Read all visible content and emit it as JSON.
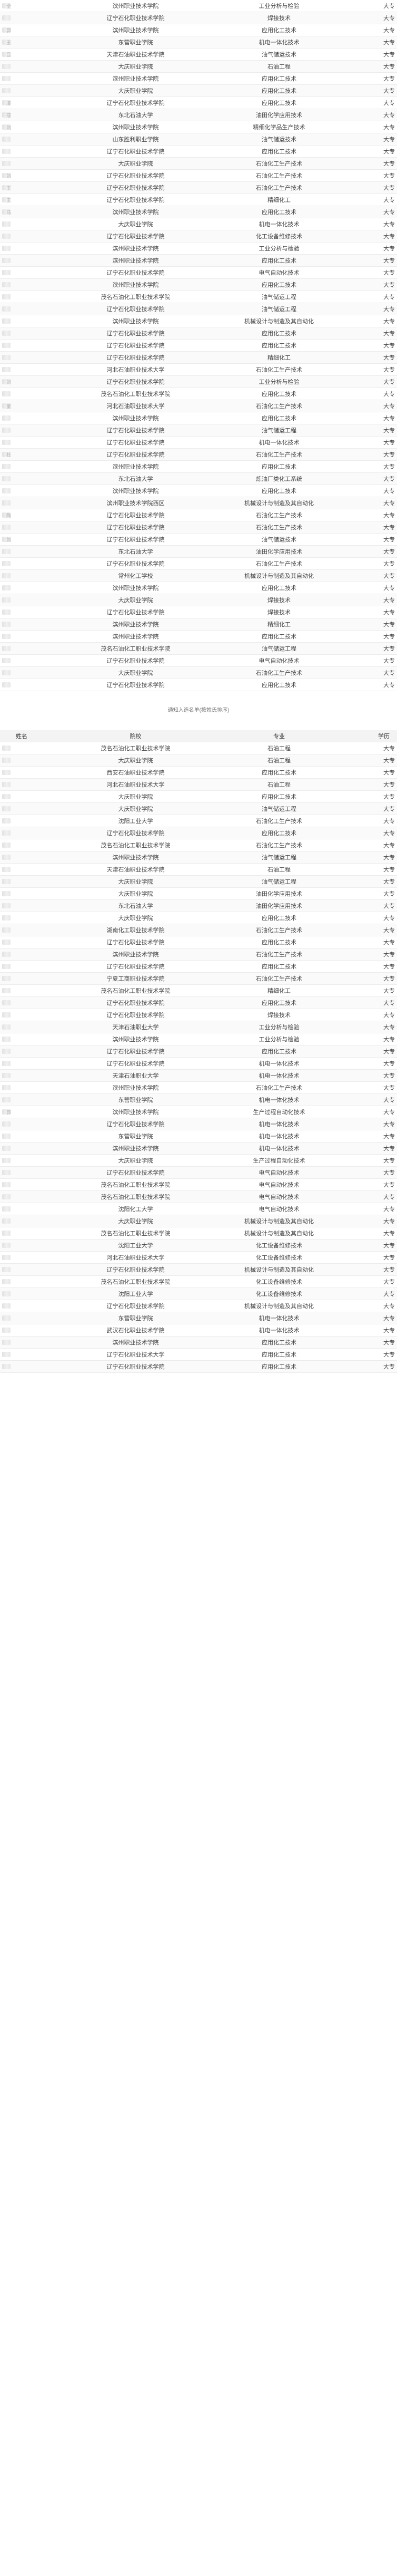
{
  "section1": {
    "rows": [
      {
        "school": "滨州职业技术学院",
        "major": "工业分析与检验",
        "edu": "大专",
        "frag": "全"
      },
      {
        "school": "辽宁石化职业技术学院",
        "major": "焊接技术",
        "edu": "大专",
        "frag": ""
      },
      {
        "school": "滨州职业技术学院",
        "major": "应用化工技术",
        "edu": "大专",
        "frag": "郭"
      },
      {
        "school": "东营职业学院",
        "major": "机电一体化技术",
        "edu": "大专",
        "frag": "王"
      },
      {
        "school": "天津石油职业技术学院",
        "major": "油气储运技术",
        "edu": "大专",
        "frag": "吕"
      },
      {
        "school": "大庆职业学院",
        "major": "石油工程",
        "edu": "大专",
        "frag": ""
      },
      {
        "school": "滨州职业技术学院",
        "major": "应用化工技术",
        "edu": "大专",
        "frag": ""
      },
      {
        "school": "大庆职业学院",
        "major": "应用化工技术",
        "edu": "大专",
        "frag": ""
      },
      {
        "school": "辽宁石化职业技术学院",
        "major": "应用化工技术",
        "edu": "大专",
        "frag": "凌"
      },
      {
        "school": "东北石油大学",
        "major": "油田化学应用技术",
        "edu": "大专",
        "frag": "寇"
      },
      {
        "school": "滨州职业技术学院",
        "major": "精细化学品生产技术",
        "edu": "大专",
        "frag": "刘"
      },
      {
        "school": "山东胜利职业学院",
        "major": "油气储运技术",
        "edu": "大专",
        "frag": ""
      },
      {
        "school": "辽宁石化职业技术学院",
        "major": "应用化工技术",
        "edu": "大专",
        "frag": ""
      },
      {
        "school": "大庆职业学院",
        "major": "石油化工生产技术",
        "edu": "大专",
        "frag": ""
      },
      {
        "school": "辽宁石化职业技术学院",
        "major": "石油化工生产技术",
        "edu": "大专",
        "frag": "刘"
      },
      {
        "school": "辽宁石化职业技术学院",
        "major": "石油化工生产技术",
        "edu": "大专",
        "frag": "王"
      },
      {
        "school": "辽宁石化职业技术学院",
        "major": "精细化工",
        "edu": "大专",
        "frag": "王"
      },
      {
        "school": "滨州职业技术学院",
        "major": "应用化工技术",
        "edu": "大专",
        "frag": "马"
      },
      {
        "school": "大庆职业学院",
        "major": "机电一体化技术",
        "edu": "大专",
        "frag": ""
      },
      {
        "school": "辽宁石化职业技术学院",
        "major": "化工设备维修技术",
        "edu": "大专",
        "frag": ""
      },
      {
        "school": "滨州职业技术学院",
        "major": "工业分析与检验",
        "edu": "大专",
        "frag": ""
      },
      {
        "school": "滨州职业技术学院",
        "major": "应用化工技术",
        "edu": "大专",
        "frag": ""
      },
      {
        "school": "辽宁石化职业技术学院",
        "major": "电气自动化技术",
        "edu": "大专",
        "frag": ""
      },
      {
        "school": "滨州职业技术学院",
        "major": "应用化工技术",
        "edu": "大专",
        "frag": ""
      },
      {
        "school": "茂名石油化工职业技术学院",
        "major": "油气储运工程",
        "edu": "大专",
        "frag": ""
      },
      {
        "school": "辽宁石化职业技术学院",
        "major": "油气储运工程",
        "edu": "大专",
        "frag": ""
      },
      {
        "school": "滨州职业技术学院",
        "major": "机械设计与制造及其自动化",
        "edu": "大专",
        "frag": ""
      },
      {
        "school": "辽宁石化职业技术学院",
        "major": "应用化工技术",
        "edu": "大专",
        "frag": ""
      },
      {
        "school": "辽宁石化职业技术学院",
        "major": "应用化工技术",
        "edu": "大专",
        "frag": ""
      },
      {
        "school": "辽宁石化职业技术学院",
        "major": "精细化工",
        "edu": "大专",
        "frag": ""
      },
      {
        "school": "河北石油职业技术大学",
        "major": "石油化工生产技术",
        "edu": "大专",
        "frag": ""
      },
      {
        "school": "辽宁石化职业技术学院",
        "major": "工业分析与检验",
        "edu": "大专",
        "frag": "刘"
      },
      {
        "school": "茂名石油化工职业技术学院",
        "major": "应用化工技术",
        "edu": "大专",
        "frag": ""
      },
      {
        "school": "河北石油职业技术大学",
        "major": "石油化工生产技术",
        "edu": "大专",
        "frag": "董"
      },
      {
        "school": "滨州职业技术学院",
        "major": "应用化工技术",
        "edu": "大专",
        "frag": ""
      },
      {
        "school": "辽宁石化职业技术学院",
        "major": "油气储运工程",
        "edu": "大专",
        "frag": ""
      },
      {
        "school": "辽宁石化职业技术学院",
        "major": "机电一体化技术",
        "edu": "大专",
        "frag": ""
      },
      {
        "school": "辽宁石化职业技术学院",
        "major": "石油化工生产技术",
        "edu": "大专",
        "frag": "杜"
      },
      {
        "school": "滨州职业技术学院",
        "major": "应用化工技术",
        "edu": "大专",
        "frag": ""
      },
      {
        "school": "东北石油大学",
        "major": "炼油厂类化工系统",
        "edu": "大专",
        "frag": ""
      },
      {
        "school": "滨州职业技术学院",
        "major": "应用化工技术",
        "edu": "大专",
        "frag": ""
      },
      {
        "school": "滨州职业技术学院西区",
        "major": "机械设计与制造及其自动化",
        "edu": "大专",
        "frag": ""
      },
      {
        "school": "辽宁石化职业技术学院",
        "major": "石油化工生产技术",
        "edu": "大专",
        "frag": "陶"
      },
      {
        "school": "辽宁石化职业技术学院",
        "major": "石油化工生产技术",
        "edu": "大专",
        "frag": ""
      },
      {
        "school": "辽宁石化职业技术学院",
        "major": "油气储运技术",
        "edu": "大专",
        "frag": "刘"
      },
      {
        "school": "东北石油大学",
        "major": "油田化学应用技术",
        "edu": "大专",
        "frag": ""
      },
      {
        "school": "辽宁石化职业技术学院",
        "major": "石油化工生产技术",
        "edu": "大专",
        "frag": ""
      },
      {
        "school": "常州化工学校",
        "major": "机械设计与制造及其自动化",
        "edu": "大专",
        "frag": ""
      },
      {
        "school": "滨州职业技术学院",
        "major": "应用化工技术",
        "edu": "大专",
        "frag": ""
      },
      {
        "school": "大庆职业学院",
        "major": "焊接技术",
        "edu": "大专",
        "frag": ""
      },
      {
        "school": "辽宁石化职业技术学院",
        "major": "焊接技术",
        "edu": "大专",
        "frag": ""
      },
      {
        "school": "滨州职业技术学院",
        "major": "精细化工",
        "edu": "大专",
        "frag": ""
      },
      {
        "school": "滨州职业技术学院",
        "major": "应用化工技术",
        "edu": "大专",
        "frag": ""
      },
      {
        "school": "茂名石油化工职业技术学院",
        "major": "油气储运工程",
        "edu": "大专",
        "frag": ""
      },
      {
        "school": "辽宁石化职业技术学院",
        "major": "电气自动化技术",
        "edu": "大专",
        "frag": ""
      },
      {
        "school": "大庆职业学院",
        "major": "石油化工生产技术",
        "edu": "大专",
        "frag": ""
      },
      {
        "school": "辽宁石化职业技术学院",
        "major": "应用化工技术",
        "edu": "大专",
        "frag": ""
      }
    ],
    "caption": "通知入选名单(按姓氏排序)"
  },
  "section2": {
    "headers": {
      "name": "姓名",
      "school": "院校",
      "major": "专业",
      "edu": "学历"
    },
    "rows": [
      {
        "school": "茂名石油化工职业技术学院",
        "major": "石油工程",
        "edu": "大专",
        "frag": ""
      },
      {
        "school": "大庆职业学院",
        "major": "石油工程",
        "edu": "大专",
        "frag": ""
      },
      {
        "school": "西安石油职业技术学院",
        "major": "应用化工技术",
        "edu": "大专",
        "frag": ""
      },
      {
        "school": "河北石油职业技术大学",
        "major": "石油工程",
        "edu": "大专",
        "frag": ""
      },
      {
        "school": "大庆职业学院",
        "major": "应用化工技术",
        "edu": "大专",
        "frag": ""
      },
      {
        "school": "大庆职业学院",
        "major": "油气储运工程",
        "edu": "大专",
        "frag": ""
      },
      {
        "school": "沈阳工业大学",
        "major": "石油化工生产技术",
        "edu": "大专",
        "frag": ""
      },
      {
        "school": "辽宁石化职业技术学院",
        "major": "应用化工技术",
        "edu": "大专",
        "frag": ""
      },
      {
        "school": "茂名石油化工职业技术学院",
        "major": "石油化工生产技术",
        "edu": "大专",
        "frag": ""
      },
      {
        "school": "滨州职业技术学院",
        "major": "油气储运工程",
        "edu": "大专",
        "frag": ""
      },
      {
        "school": "天津石油职业技术学院",
        "major": "石油工程",
        "edu": "大专",
        "frag": ""
      },
      {
        "school": "大庆职业学院",
        "major": "油气储运工程",
        "edu": "大专",
        "frag": ""
      },
      {
        "school": "大庆职业学院",
        "major": "油田化学应用技术",
        "edu": "大专",
        "frag": ""
      },
      {
        "school": "东北石油大学",
        "major": "油田化学应用技术",
        "edu": "大专",
        "frag": ""
      },
      {
        "school": "大庆职业学院",
        "major": "应用化工技术",
        "edu": "大专",
        "frag": ""
      },
      {
        "school": "湖南化工职业技术学院",
        "major": "石油化工生产技术",
        "edu": "大专",
        "frag": ""
      },
      {
        "school": "辽宁石化职业技术学院",
        "major": "应用化工技术",
        "edu": "大专",
        "frag": ""
      },
      {
        "school": "滨州职业技术学院",
        "major": "石油化工生产技术",
        "edu": "大专",
        "frag": ""
      },
      {
        "school": "辽宁石化职业技术学院",
        "major": "应用化工技术",
        "edu": "大专",
        "frag": ""
      },
      {
        "school": "宁夏工商职业技术学院",
        "major": "石油化工生产技术",
        "edu": "大专",
        "frag": ""
      },
      {
        "school": "茂名石油化工职业技术学院",
        "major": "精细化工",
        "edu": "大专",
        "frag": ""
      },
      {
        "school": "辽宁石化职业技术学院",
        "major": "应用化工技术",
        "edu": "大专",
        "frag": ""
      },
      {
        "school": "辽宁石化职业技术学院",
        "major": "焊接技术",
        "edu": "大专",
        "frag": ""
      },
      {
        "school": "天津石油职业大学",
        "major": "工业分析与检验",
        "edu": "大专",
        "frag": ""
      },
      {
        "school": "滨州职业技术学院",
        "major": "工业分析与检验",
        "edu": "大专",
        "frag": ""
      },
      {
        "school": "辽宁石化职业技术学院",
        "major": "应用化工技术",
        "edu": "大专",
        "frag": ""
      },
      {
        "school": "辽宁石化职业技术学院",
        "major": "机电一体化技术",
        "edu": "大专",
        "frag": ""
      },
      {
        "school": "天津石油职业大学",
        "major": "机电一体化技术",
        "edu": "大专",
        "frag": ""
      },
      {
        "school": "滨州职业技术学院",
        "major": "石油化工生产技术",
        "edu": "大专",
        "frag": ""
      },
      {
        "school": "东营职业学院",
        "major": "机电一体化技术",
        "edu": "大专",
        "frag": ""
      },
      {
        "school": "滨州职业技术学院",
        "major": "生产过程自动化技术",
        "edu": "大专",
        "frag": "郭"
      },
      {
        "school": "辽宁石化职业技术学院",
        "major": "机电一体化技术",
        "edu": "大专",
        "frag": ""
      },
      {
        "school": "东营职业学院",
        "major": "机电一体化技术",
        "edu": "大专",
        "frag": ""
      },
      {
        "school": "滨州职业技术学院",
        "major": "机电一体化技术",
        "edu": "大专",
        "frag": ""
      },
      {
        "school": "大庆职业学院",
        "major": "生产过程自动化技术",
        "edu": "大专",
        "frag": ""
      },
      {
        "school": "辽宁石化职业技术学院",
        "major": "电气自动化技术",
        "edu": "大专",
        "frag": ""
      },
      {
        "school": "茂名石油化工职业技术学院",
        "major": "电气自动化技术",
        "edu": "大专",
        "frag": ""
      },
      {
        "school": "茂名石油化工职业技术学院",
        "major": "电气自动化技术",
        "edu": "大专",
        "frag": ""
      },
      {
        "school": "沈阳化工大学",
        "major": "电气自动化技术",
        "edu": "大专",
        "frag": ""
      },
      {
        "school": "大庆职业学院",
        "major": "机械设计与制造及其自动化",
        "edu": "大专",
        "frag": ""
      },
      {
        "school": "茂名石油化工职业技术学院",
        "major": "机械设计与制造及其自动化",
        "edu": "大专",
        "frag": ""
      },
      {
        "school": "沈阳工业大学",
        "major": "化工设备维修技术",
        "edu": "大专",
        "frag": ""
      },
      {
        "school": "河北石油职业技术大学",
        "major": "化工设备维修技术",
        "edu": "大专",
        "frag": ""
      },
      {
        "school": "辽宁石化职业技术学院",
        "major": "机械设计与制造及其自动化",
        "edu": "大专",
        "frag": ""
      },
      {
        "school": "茂名石油化工职业技术学院",
        "major": "化工设备维修技术",
        "edu": "大专",
        "frag": ""
      },
      {
        "school": "沈阳工业大学",
        "major": "化工设备维修技术",
        "edu": "大专",
        "frag": ""
      },
      {
        "school": "辽宁石化职业技术学院",
        "major": "机械设计与制造及其自动化",
        "edu": "大专",
        "frag": ""
      },
      {
        "school": "东营职业学院",
        "major": "机电一体化技术",
        "edu": "大专",
        "frag": ""
      },
      {
        "school": "武汉石化职业技术学院",
        "major": "机电一体化技术",
        "edu": "大专",
        "frag": ""
      },
      {
        "school": "滨州职业技术学院",
        "major": "应用化工技术",
        "edu": "大专",
        "frag": ""
      },
      {
        "school": "辽宁石化职业技术大学",
        "major": "应用化工技术",
        "edu": "大专",
        "frag": ""
      },
      {
        "school": "辽宁石化职业技术学院",
        "major": "应用化工技术",
        "edu": "大专",
        "frag": ""
      }
    ]
  }
}
